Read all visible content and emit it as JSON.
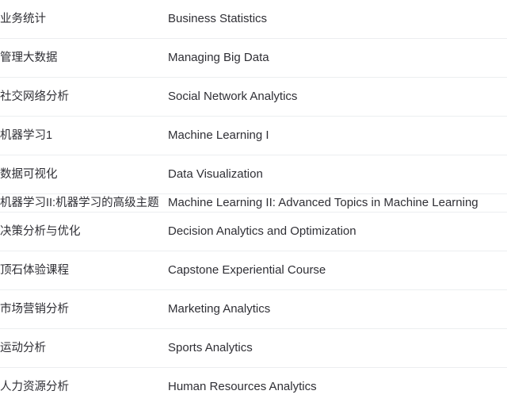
{
  "table": {
    "columns": [
      "chinese_name",
      "english_name"
    ],
    "rows": [
      {
        "zh": "业务统计",
        "en": "Business Statistics"
      },
      {
        "zh": "管理大数据",
        "en": "Managing Big Data"
      },
      {
        "zh": "社交网络分析",
        "en": "Social Network Analytics"
      },
      {
        "zh": "机器学习1",
        "en": "Machine Learning I"
      },
      {
        "zh": "数据可视化",
        "en": "Data Visualization"
      },
      {
        "zh": "机器学习II:机器学习的高级主题",
        "en": "Machine Learning II: Advanced Topics in Machine Learning"
      },
      {
        "zh": "决策分析与优化",
        "en": "Decision Analytics and Optimization"
      },
      {
        "zh": "顶石体验课程",
        "en": "Capstone Experiential Course"
      },
      {
        "zh": "市场营销分析",
        "en": "Marketing Analytics"
      },
      {
        "zh": "运动分析",
        "en": "Sports Analytics"
      },
      {
        "zh": "人力资源分析",
        "en": "Human Resources Analytics"
      }
    ]
  },
  "colors": {
    "text": "#2f2f35",
    "divider": "#eceef0",
    "background": "#ffffff"
  }
}
